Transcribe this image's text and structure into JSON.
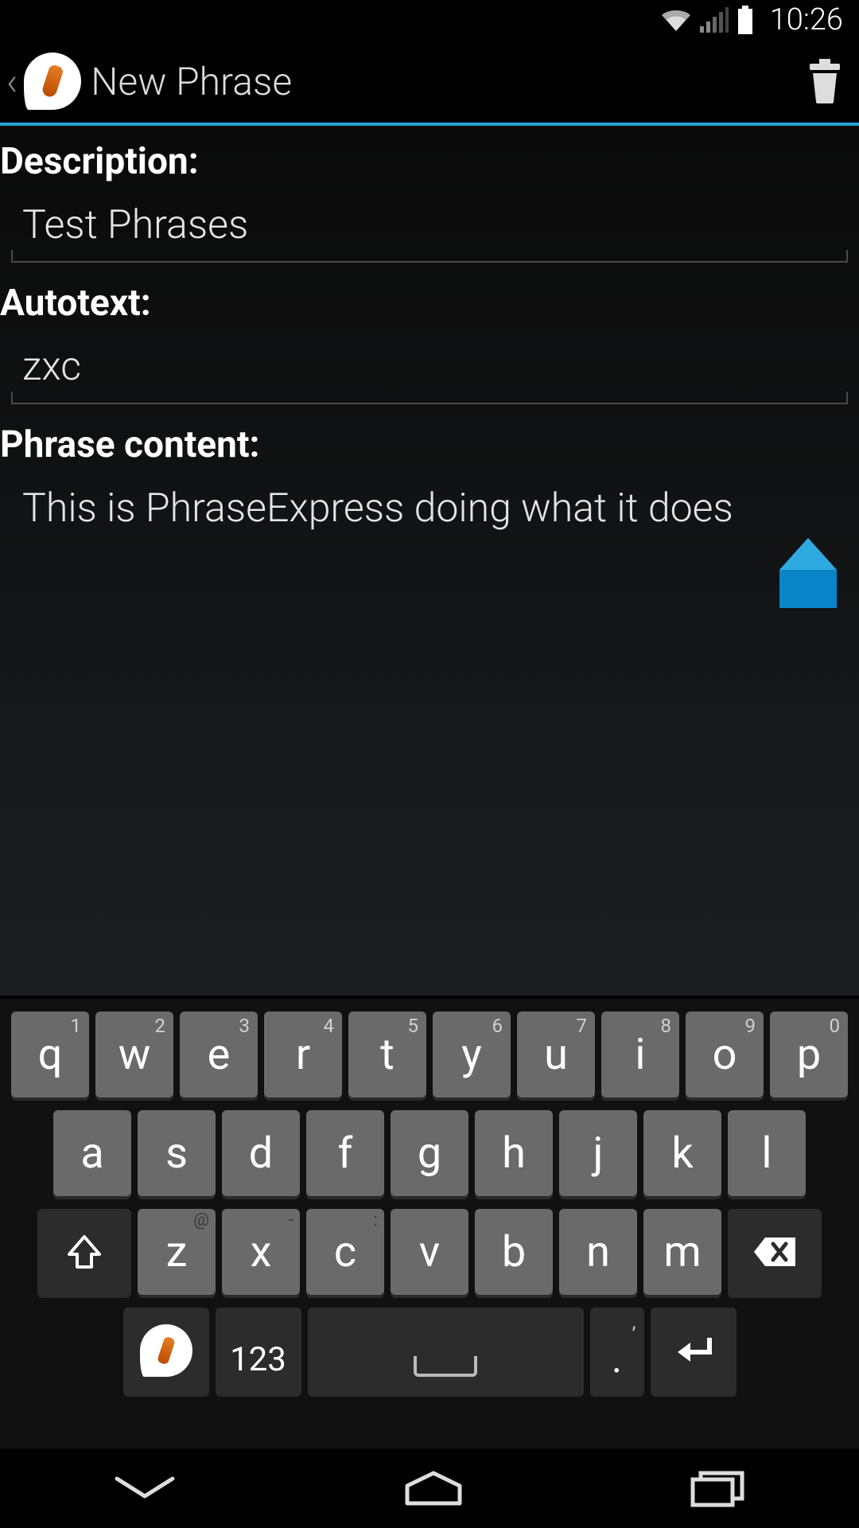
{
  "status": {
    "time": "10:26"
  },
  "actionBar": {
    "title": "New Phrase"
  },
  "form": {
    "descriptionLabel": "Description:",
    "descriptionValue": "Test Phrases",
    "autotextLabel": "Autotext:",
    "autotextValue": "zxc",
    "phraseContentLabel": "Phrase content:",
    "phraseContentValue": "This is PhraseExpress doing what it does"
  },
  "keyboard": {
    "row1": [
      {
        "main": "q",
        "sup": "1"
      },
      {
        "main": "w",
        "sup": "2"
      },
      {
        "main": "e",
        "sup": "3"
      },
      {
        "main": "r",
        "sup": "4"
      },
      {
        "main": "t",
        "sup": "5"
      },
      {
        "main": "y",
        "sup": "6"
      },
      {
        "main": "u",
        "sup": "7"
      },
      {
        "main": "i",
        "sup": "8"
      },
      {
        "main": "o",
        "sup": "9"
      },
      {
        "main": "p",
        "sup": "0"
      }
    ],
    "row2": [
      {
        "main": "a"
      },
      {
        "main": "s"
      },
      {
        "main": "d"
      },
      {
        "main": "f"
      },
      {
        "main": "g"
      },
      {
        "main": "h"
      },
      {
        "main": "j"
      },
      {
        "main": "k"
      },
      {
        "main": "l"
      }
    ],
    "row3": [
      {
        "main": "z",
        "sup": "@"
      },
      {
        "main": "x",
        "sup": "-"
      },
      {
        "main": "c",
        "sup": ":"
      },
      {
        "main": "v"
      },
      {
        "main": "b"
      },
      {
        "main": "n"
      },
      {
        "main": "m"
      }
    ],
    "numKey": "123",
    "periodKey": ".",
    "periodSup": ","
  }
}
